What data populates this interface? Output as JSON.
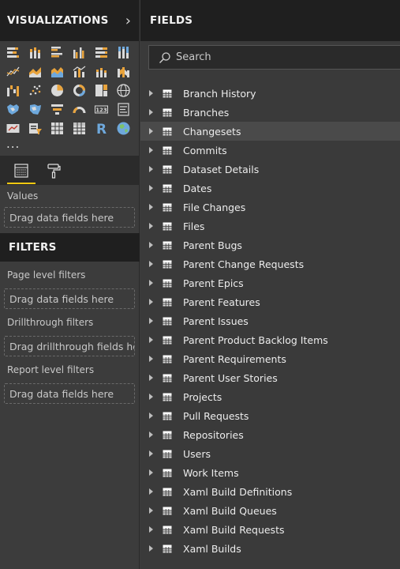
{
  "visualizations": {
    "title": "VISUALIZATIONS",
    "collapse_icon": "chevron-right-icon",
    "icons": [
      "stacked-bar-icon",
      "stacked-column-icon",
      "clustered-bar-icon",
      "clustered-column-icon",
      "100-stacked-bar-icon",
      "100-stacked-column-icon",
      "line-chart-icon",
      "area-chart-icon",
      "stacked-area-icon",
      "line-clustered-column-icon",
      "line-stacked-column-icon",
      "ribbon-chart-icon",
      "waterfall-icon",
      "scatter-icon",
      "pie-icon",
      "donut-icon",
      "treemap-icon",
      "map-icon",
      "filled-map-icon",
      "shape-map-icon",
      "funnel-icon",
      "gauge-icon",
      "card-icon",
      "multi-row-card-icon",
      "kpi-icon",
      "slicer-icon",
      "table-icon",
      "matrix-icon",
      "r-visual-icon",
      "arcgis-map-icon"
    ],
    "more_label": "...",
    "tabs": [
      {
        "name": "fields-tab",
        "icon": "fields-icon",
        "active": true
      },
      {
        "name": "format-tab",
        "icon": "paint-roller-icon",
        "active": false
      }
    ],
    "values_label": "Values",
    "values_drop": "Drag data fields here"
  },
  "filters": {
    "title": "FILTERS",
    "page_label": "Page level filters",
    "page_drop": "Drag data fields here",
    "drill_label": "Drillthrough filters",
    "drill_drop": "Drag drillthrough fields here",
    "report_label": "Report level filters",
    "report_drop": "Drag data fields here"
  },
  "fields": {
    "title": "FIELDS",
    "search_placeholder": "Search",
    "tables": [
      "Branch History",
      "Branches",
      "Changesets",
      "Commits",
      "Dataset Details",
      "Dates",
      "File Changes",
      "Files",
      "Parent Bugs",
      "Parent Change Requests",
      "Parent Epics",
      "Parent Features",
      "Parent Issues",
      "Parent Product Backlog Items",
      "Parent Requirements",
      "Parent User Stories",
      "Projects",
      "Pull Requests",
      "Repositories",
      "Users",
      "Work Items",
      "Xaml Build Definitions",
      "Xaml Build Queues",
      "Xaml Build Requests",
      "Xaml Builds"
    ],
    "hovered_index": 2
  },
  "colors": {
    "accent_yellow": "#f2c811",
    "orange": "#e8a33c",
    "blue": "#6ea8dc",
    "panel_dark": "#1f1f1f",
    "panel": "#3c3c3c"
  }
}
